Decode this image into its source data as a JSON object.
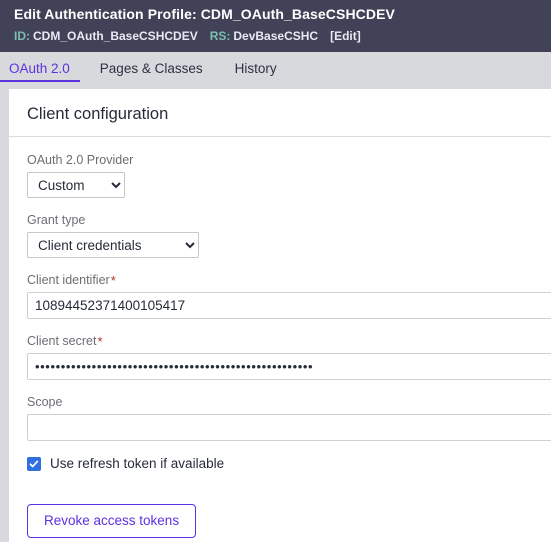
{
  "header": {
    "title": "Edit  Authentication Profile: CDM_OAuth_BaseCSHCDEV",
    "id_label": "ID:",
    "id_value": "CDM_OAuth_BaseCSHCDEV",
    "rs_label": "RS:",
    "rs_value": "DevBaseCSHC",
    "edit_link": "[Edit]",
    "bar_color": "#414257",
    "label_color": "#7bbfb0"
  },
  "tabs": [
    {
      "label": "OAuth 2.0",
      "active": true
    },
    {
      "label": "Pages & Classes",
      "active": false
    },
    {
      "label": "History",
      "active": false
    }
  ],
  "accent_color": "#5b32e0",
  "card": {
    "title": "Client configuration",
    "provider": {
      "label": "OAuth 2.0 Provider",
      "value": "Custom",
      "options": [
        "Custom"
      ]
    },
    "grant_type": {
      "label": "Grant type",
      "value": "Client credentials",
      "options": [
        "Client credentials"
      ]
    },
    "client_identifier": {
      "label": "Client identifier",
      "required_marker": "*",
      "value": "10894452371400105417",
      "placeholder": ""
    },
    "client_secret": {
      "label": "Client secret",
      "required_marker": "*",
      "value": "••••••••••••••••••••••••••••••••••••••••••••••••••••••",
      "placeholder": ""
    },
    "scope": {
      "label": "Scope",
      "value": "",
      "placeholder": ""
    },
    "refresh_token": {
      "label": "Use refresh token if available",
      "checked": true
    },
    "revoke_button": {
      "label": "Revoke access tokens"
    }
  }
}
